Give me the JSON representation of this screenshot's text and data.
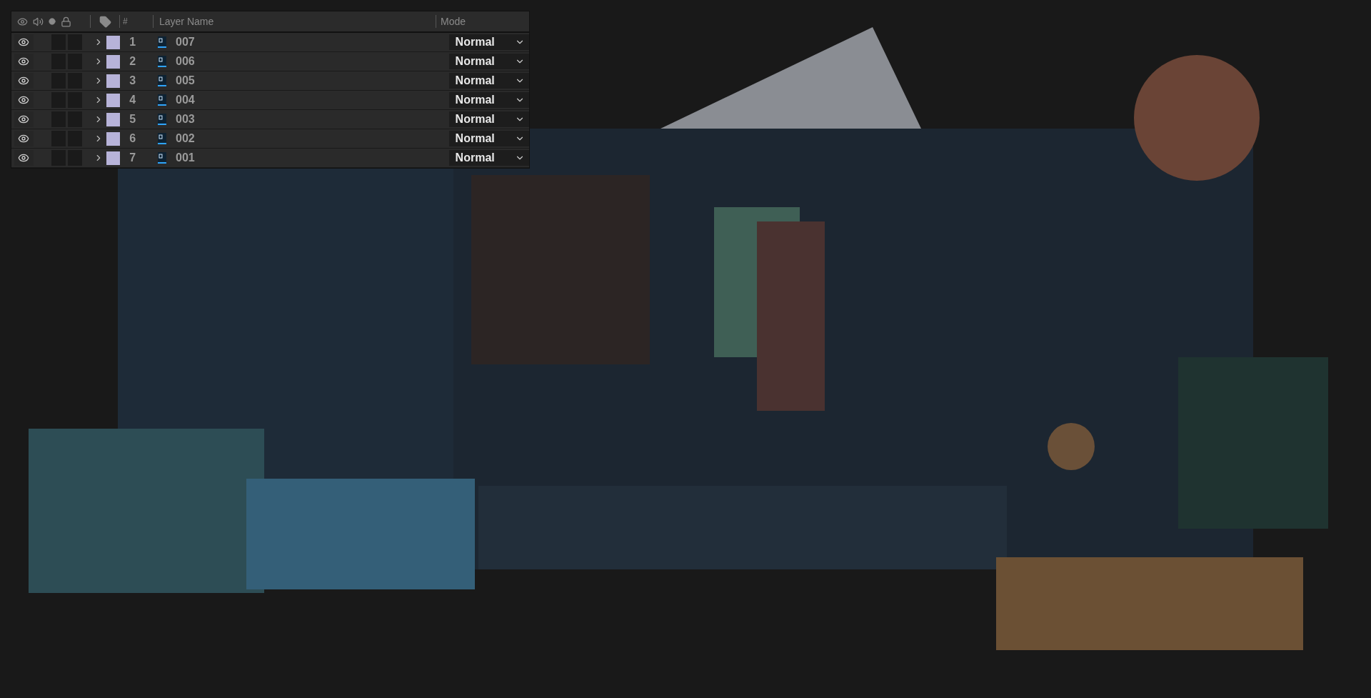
{
  "layer_panel": {
    "columns": {
      "number": "#",
      "layer_name": "Layer Name",
      "mode": "Mode"
    },
    "layers": [
      {
        "visible": true,
        "audio": false,
        "solo": false,
        "color": "#b7b3d9",
        "number": "1",
        "name": "007",
        "mode": "Normal"
      },
      {
        "visible": true,
        "audio": false,
        "solo": false,
        "color": "#b7b3d9",
        "number": "2",
        "name": "006",
        "mode": "Normal"
      },
      {
        "visible": true,
        "audio": false,
        "solo": false,
        "color": "#b7b3d9",
        "number": "3",
        "name": "005",
        "mode": "Normal"
      },
      {
        "visible": true,
        "audio": false,
        "solo": false,
        "color": "#b7b3d9",
        "number": "4",
        "name": "004",
        "mode": "Normal"
      },
      {
        "visible": true,
        "audio": false,
        "solo": false,
        "color": "#b7b3d9",
        "number": "5",
        "name": "003",
        "mode": "Normal"
      },
      {
        "visible": true,
        "audio": false,
        "solo": false,
        "color": "#b7b3d9",
        "number": "6",
        "name": "002",
        "mode": "Normal"
      },
      {
        "visible": true,
        "audio": false,
        "solo": false,
        "color": "#b7b3d9",
        "number": "7",
        "name": "001",
        "mode": "Normal"
      }
    ]
  }
}
